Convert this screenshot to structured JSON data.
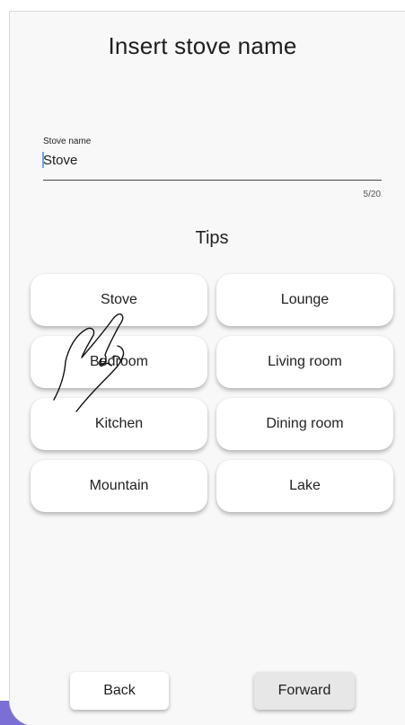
{
  "title": "Insert stove name",
  "stove_name_field": {
    "label": "Stove name",
    "value": "Stove",
    "counter": "5/20"
  },
  "tips": {
    "title": "Tips",
    "items": [
      {
        "label": "Stove"
      },
      {
        "label": "Lounge"
      },
      {
        "label": "Bedroom"
      },
      {
        "label": "Living room"
      },
      {
        "label": "Kitchen"
      },
      {
        "label": "Dining room"
      },
      {
        "label": "Mountain"
      },
      {
        "label": "Lake"
      }
    ]
  },
  "navigation": {
    "back_label": "Back",
    "forward_label": "Forward"
  },
  "gesture_hint": {
    "icon": "tap-hand-icon"
  },
  "colors": {
    "background": "#f8f8f8",
    "tip_background": "#ffffff",
    "forward_background": "#e7e7e7",
    "caret": "#6fa4e6",
    "corner_accent": "#7b6fd6"
  }
}
